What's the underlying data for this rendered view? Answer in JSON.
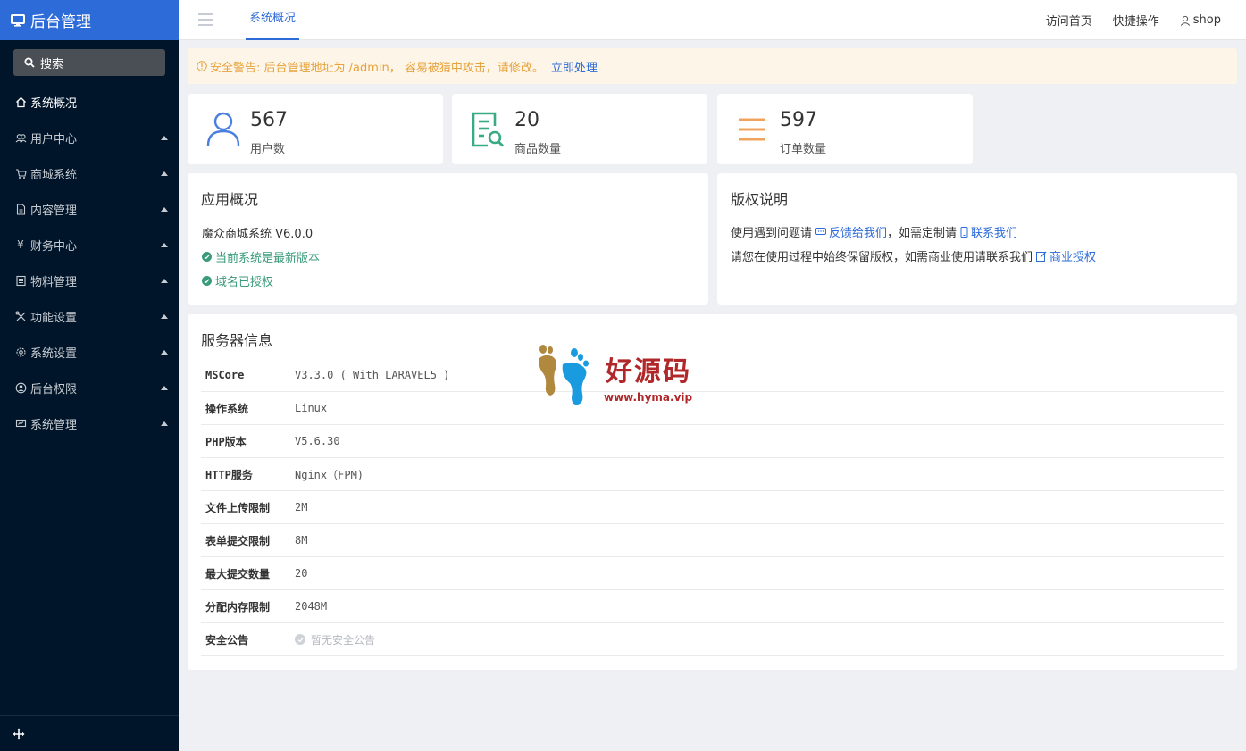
{
  "app": {
    "title": "后台管理"
  },
  "search": {
    "label": "搜索"
  },
  "sidebar": {
    "items": [
      {
        "label": "系统概况",
        "icon": "home-icon",
        "active": true
      },
      {
        "label": "用户中心",
        "icon": "users-icon"
      },
      {
        "label": "商城系统",
        "icon": "cart-icon"
      },
      {
        "label": "内容管理",
        "icon": "document-icon"
      },
      {
        "label": "财务中心",
        "icon": "yen-icon"
      },
      {
        "label": "物料管理",
        "icon": "list-icon"
      },
      {
        "label": "功能设置",
        "icon": "tools-icon"
      },
      {
        "label": "系统设置",
        "icon": "gear-icon"
      },
      {
        "label": "后台权限",
        "icon": "user-circle-icon"
      },
      {
        "label": "系统管理",
        "icon": "monitor-icon"
      }
    ]
  },
  "header": {
    "active_tab": "系统概况",
    "links": {
      "visit_home": "访问首页",
      "quick_ops": "快捷操作",
      "user": "shop"
    }
  },
  "alert": {
    "message": "安全警告: 后台管理地址为 /admin， 容易被猜中攻击，请修改。",
    "action": "立即处理"
  },
  "stats": [
    {
      "value": "567",
      "label": "用户数"
    },
    {
      "value": "20",
      "label": "商品数量"
    },
    {
      "value": "597",
      "label": "订单数量"
    }
  ],
  "app_overview": {
    "title": "应用概况",
    "version": "魔众商城系统 V6.0.0",
    "latest": "当前系统是最新版本",
    "licensed": "域名已授权"
  },
  "copyright": {
    "title": "版权说明",
    "line1_prefix": "使用遇到问题请",
    "feedback": "反馈给我们",
    "line1_mid": "，如需定制请",
    "contact": "联系我们",
    "line2_prefix": "请您在使用过程中始终保留版权，如需商业使用请联系我们",
    "license": "商业授权"
  },
  "server": {
    "title": "服务器信息",
    "rows": [
      {
        "key": "MSCore",
        "value": "V3.3.0 ( With LARAVEL5 )"
      },
      {
        "key": "操作系统",
        "value": "Linux"
      },
      {
        "key": "PHP版本",
        "value": "V5.6.30"
      },
      {
        "key": "HTTP服务",
        "value": "Nginx（FPM)"
      },
      {
        "key": "文件上传限制",
        "value": "2M"
      },
      {
        "key": "表单提交限制",
        "value": "8M"
      },
      {
        "key": "最大提交数量",
        "value": "20"
      },
      {
        "key": "分配内存限制",
        "value": "2048M"
      },
      {
        "key": "安全公告",
        "value": "暂无安全公告"
      }
    ]
  },
  "watermark": {
    "text": "好源码",
    "url": "www.hyma.vip"
  },
  "colors": {
    "primary": "#2d6bd8",
    "sidebar": "#001529",
    "warning": "#e6a23c",
    "success": "#3a9b7a"
  }
}
